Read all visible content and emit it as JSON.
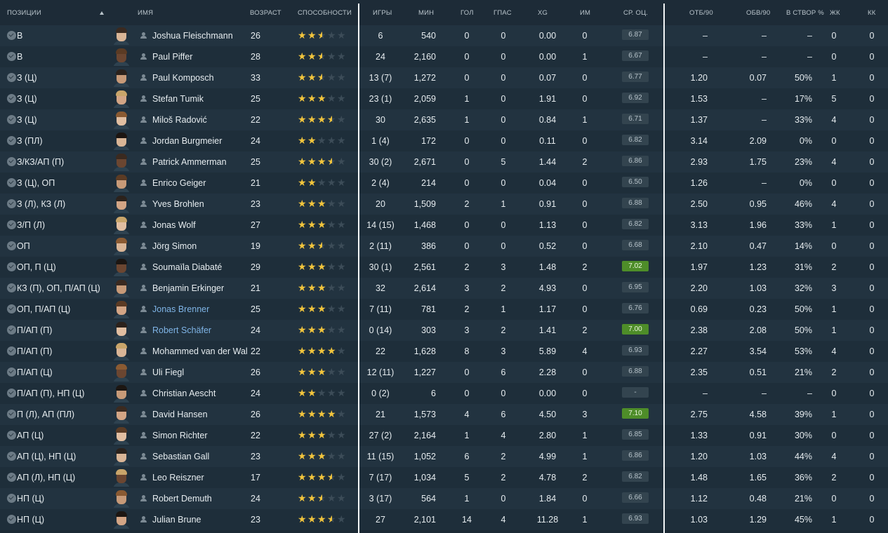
{
  "headers": {
    "position": "ПОЗИЦИИ",
    "name": "ИМЯ",
    "age": "ВОЗРАСТ",
    "ability": "СПОСОБНОСТИ",
    "games": "ИГРЫ",
    "minutes": "МИН",
    "goals": "ГОЛ",
    "assists": "ГПАС",
    "xg": "XG",
    "pom": "ИМ",
    "avg_rating": "СР. ОЦ.",
    "tackles90": "ОТБ/90",
    "dribbles90": "ОБВ/90",
    "on_target": "В СТВОР %",
    "yellow": "ЖК",
    "red": "КК"
  },
  "colors": {
    "background": "#1b2934",
    "row_odd": "#223340",
    "row_even": "#1e2e3a",
    "star": "#f2c53d",
    "rating_high": "#4e8d29",
    "link": "#7fb4e6"
  },
  "players": [
    {
      "position": "В",
      "name": "Joshua Fleischmann",
      "age": "26",
      "stars": 2.5,
      "games": "6",
      "minutes": "540",
      "goals": "0",
      "assists": "0",
      "xg": "0.00",
      "pom": "0",
      "rating": "6.87",
      "tackles90": "–",
      "dribbles90": "–",
      "on_target": "–",
      "yellow": "0",
      "red": "0",
      "link": false,
      "high": false
    },
    {
      "position": "В",
      "name": "Paul Piffer",
      "age": "28",
      "stars": 2.5,
      "games": "24",
      "minutes": "2,160",
      "goals": "0",
      "assists": "0",
      "xg": "0.00",
      "pom": "1",
      "rating": "6.67",
      "tackles90": "–",
      "dribbles90": "–",
      "on_target": "–",
      "yellow": "0",
      "red": "0",
      "link": false,
      "high": false
    },
    {
      "position": "З (Ц)",
      "name": "Paul Komposch",
      "age": "33",
      "stars": 2.5,
      "games": "13 (7)",
      "minutes": "1,272",
      "goals": "0",
      "assists": "0",
      "xg": "0.07",
      "pom": "0",
      "rating": "6.77",
      "tackles90": "1.20",
      "dribbles90": "0.07",
      "on_target": "50%",
      "yellow": "1",
      "red": "0",
      "link": false,
      "high": false
    },
    {
      "position": "З (Ц)",
      "name": "Stefan Tumik",
      "age": "25",
      "stars": 3,
      "games": "23 (1)",
      "minutes": "2,059",
      "goals": "1",
      "assists": "0",
      "xg": "1.91",
      "pom": "0",
      "rating": "6.92",
      "tackles90": "1.53",
      "dribbles90": "–",
      "on_target": "17%",
      "yellow": "5",
      "red": "0",
      "link": false,
      "high": false
    },
    {
      "position": "З (Ц)",
      "name": "Miloš Radović",
      "age": "22",
      "stars": 3.5,
      "games": "30",
      "minutes": "2,635",
      "goals": "1",
      "assists": "0",
      "xg": "0.84",
      "pom": "1",
      "rating": "6.71",
      "tackles90": "1.37",
      "dribbles90": "–",
      "on_target": "33%",
      "yellow": "4",
      "red": "0",
      "link": false,
      "high": false
    },
    {
      "position": "З (ПЛ)",
      "name": "Jordan Burgmeier",
      "age": "24",
      "stars": 2,
      "games": "1 (4)",
      "minutes": "172",
      "goals": "0",
      "assists": "0",
      "xg": "0.11",
      "pom": "0",
      "rating": "6.82",
      "tackles90": "3.14",
      "dribbles90": "2.09",
      "on_target": "0%",
      "yellow": "0",
      "red": "0",
      "link": false,
      "high": false
    },
    {
      "position": "З/КЗ/АП (П)",
      "name": "Patrick Ammerman",
      "age": "25",
      "stars": 3.5,
      "games": "30 (2)",
      "minutes": "2,671",
      "goals": "0",
      "assists": "5",
      "xg": "1.44",
      "pom": "2",
      "rating": "6.86",
      "tackles90": "2.93",
      "dribbles90": "1.75",
      "on_target": "23%",
      "yellow": "4",
      "red": "0",
      "link": false,
      "high": false
    },
    {
      "position": "З (Ц), ОП",
      "name": "Enrico Geiger",
      "age": "21",
      "stars": 2,
      "games": "2 (4)",
      "minutes": "214",
      "goals": "0",
      "assists": "0",
      "xg": "0.04",
      "pom": "0",
      "rating": "6.50",
      "tackles90": "1.26",
      "dribbles90": "–",
      "on_target": "0%",
      "yellow": "0",
      "red": "0",
      "link": false,
      "high": false
    },
    {
      "position": "З (Л), КЗ (Л)",
      "name": "Yves Brohlen",
      "age": "23",
      "stars": 3,
      "games": "20",
      "minutes": "1,509",
      "goals": "2",
      "assists": "1",
      "xg": "0.91",
      "pom": "0",
      "rating": "6.88",
      "tackles90": "2.50",
      "dribbles90": "0.95",
      "on_target": "46%",
      "yellow": "4",
      "red": "0",
      "link": false,
      "high": false
    },
    {
      "position": "З/П (Л)",
      "name": "Jonas Wolf",
      "age": "27",
      "stars": 3,
      "games": "14 (15)",
      "minutes": "1,468",
      "goals": "0",
      "assists": "0",
      "xg": "1.13",
      "pom": "0",
      "rating": "6.82",
      "tackles90": "3.13",
      "dribbles90": "1.96",
      "on_target": "33%",
      "yellow": "1",
      "red": "0",
      "link": false,
      "high": false
    },
    {
      "position": "ОП",
      "name": "Jörg Simon",
      "age": "19",
      "stars": 2.5,
      "games": "2 (11)",
      "minutes": "386",
      "goals": "0",
      "assists": "0",
      "xg": "0.52",
      "pom": "0",
      "rating": "6.68",
      "tackles90": "2.10",
      "dribbles90": "0.47",
      "on_target": "14%",
      "yellow": "0",
      "red": "0",
      "link": false,
      "high": false
    },
    {
      "position": "ОП, П (Ц)",
      "name": "Soumaïla Diabaté",
      "age": "29",
      "stars": 3,
      "games": "30 (1)",
      "minutes": "2,561",
      "goals": "2",
      "assists": "3",
      "xg": "1.48",
      "pom": "2",
      "rating": "7.02",
      "tackles90": "1.97",
      "dribbles90": "1.23",
      "on_target": "31%",
      "yellow": "2",
      "red": "0",
      "link": false,
      "high": true
    },
    {
      "position": "КЗ (П), ОП, П/АП (Ц)",
      "name": "Benjamin Erkinger",
      "age": "21",
      "stars": 3,
      "games": "32",
      "minutes": "2,614",
      "goals": "3",
      "assists": "2",
      "xg": "4.93",
      "pom": "0",
      "rating": "6.95",
      "tackles90": "2.20",
      "dribbles90": "1.03",
      "on_target": "32%",
      "yellow": "3",
      "red": "0",
      "link": false,
      "high": false
    },
    {
      "position": "ОП, П/АП (Ц)",
      "name": "Jonas Brenner",
      "age": "25",
      "stars": 3,
      "games": "7 (11)",
      "minutes": "781",
      "goals": "2",
      "assists": "1",
      "xg": "1.17",
      "pom": "0",
      "rating": "6.76",
      "tackles90": "0.69",
      "dribbles90": "0.23",
      "on_target": "50%",
      "yellow": "1",
      "red": "0",
      "link": true,
      "high": false
    },
    {
      "position": "П/АП (П)",
      "name": "Robert Schäfer",
      "age": "24",
      "stars": 3,
      "games": "0 (14)",
      "minutes": "303",
      "goals": "3",
      "assists": "2",
      "xg": "1.41",
      "pom": "2",
      "rating": "7.00",
      "tackles90": "2.38",
      "dribbles90": "2.08",
      "on_target": "50%",
      "yellow": "1",
      "red": "0",
      "link": true,
      "high": true
    },
    {
      "position": "П/АП (П)",
      "name": "Mohammed van der Wal",
      "age": "22",
      "stars": 4,
      "games": "22",
      "minutes": "1,628",
      "goals": "8",
      "assists": "3",
      "xg": "5.89",
      "pom": "4",
      "rating": "6.93",
      "tackles90": "2.27",
      "dribbles90": "3.54",
      "on_target": "53%",
      "yellow": "4",
      "red": "0",
      "link": false,
      "high": false
    },
    {
      "position": "П/АП (Ц)",
      "name": "Uli Fiegl",
      "age": "26",
      "stars": 3,
      "games": "12 (11)",
      "minutes": "1,227",
      "goals": "0",
      "assists": "6",
      "xg": "2.28",
      "pom": "0",
      "rating": "6.88",
      "tackles90": "2.35",
      "dribbles90": "0.51",
      "on_target": "21%",
      "yellow": "2",
      "red": "0",
      "link": false,
      "high": false
    },
    {
      "position": "П/АП (П), НП (Ц)",
      "name": "Christian Aescht",
      "age": "24",
      "stars": 2,
      "games": "0 (2)",
      "minutes": "6",
      "goals": "0",
      "assists": "0",
      "xg": "0.00",
      "pom": "0",
      "rating": "-",
      "tackles90": "–",
      "dribbles90": "–",
      "on_target": "–",
      "yellow": "0",
      "red": "0",
      "link": false,
      "high": false
    },
    {
      "position": "П (Л), АП (ПЛ)",
      "name": "David Hansen",
      "age": "26",
      "stars": 4,
      "games": "21",
      "minutes": "1,573",
      "goals": "4",
      "assists": "6",
      "xg": "4.50",
      "pom": "3",
      "rating": "7.10",
      "tackles90": "2.75",
      "dribbles90": "4.58",
      "on_target": "39%",
      "yellow": "1",
      "red": "0",
      "link": false,
      "high": true
    },
    {
      "position": "АП (Ц)",
      "name": "Simon Richter",
      "age": "22",
      "stars": 3,
      "games": "27 (2)",
      "minutes": "2,164",
      "goals": "1",
      "assists": "4",
      "xg": "2.80",
      "pom": "1",
      "rating": "6.85",
      "tackles90": "1.33",
      "dribbles90": "0.91",
      "on_target": "30%",
      "yellow": "0",
      "red": "0",
      "link": false,
      "high": false
    },
    {
      "position": "АП (Ц), НП (Ц)",
      "name": "Sebastian Gall",
      "age": "23",
      "stars": 3,
      "games": "11 (15)",
      "minutes": "1,052",
      "goals": "6",
      "assists": "2",
      "xg": "4.99",
      "pom": "1",
      "rating": "6.86",
      "tackles90": "1.20",
      "dribbles90": "1.03",
      "on_target": "44%",
      "yellow": "4",
      "red": "0",
      "link": false,
      "high": false
    },
    {
      "position": "АП (Л), НП (Ц)",
      "name": "Leo Reiszner",
      "age": "17",
      "stars": 3.5,
      "games": "7 (17)",
      "minutes": "1,034",
      "goals": "5",
      "assists": "2",
      "xg": "4.78",
      "pom": "2",
      "rating": "6.82",
      "tackles90": "1.48",
      "dribbles90": "1.65",
      "on_target": "36%",
      "yellow": "2",
      "red": "0",
      "link": false,
      "high": false
    },
    {
      "position": "НП (Ц)",
      "name": "Robert Demuth",
      "age": "24",
      "stars": 2.5,
      "games": "3 (17)",
      "minutes": "564",
      "goals": "1",
      "assists": "0",
      "xg": "1.84",
      "pom": "0",
      "rating": "6.66",
      "tackles90": "1.12",
      "dribbles90": "0.48",
      "on_target": "21%",
      "yellow": "0",
      "red": "0",
      "link": false,
      "high": false
    },
    {
      "position": "НП (Ц)",
      "name": "Julian Brune",
      "age": "23",
      "stars": 3.5,
      "games": "27",
      "minutes": "2,101",
      "goals": "14",
      "assists": "4",
      "xg": "11.28",
      "pom": "1",
      "rating": "6.93",
      "tackles90": "1.03",
      "dribbles90": "1.29",
      "on_target": "45%",
      "yellow": "1",
      "red": "0",
      "link": false,
      "high": false
    }
  ]
}
